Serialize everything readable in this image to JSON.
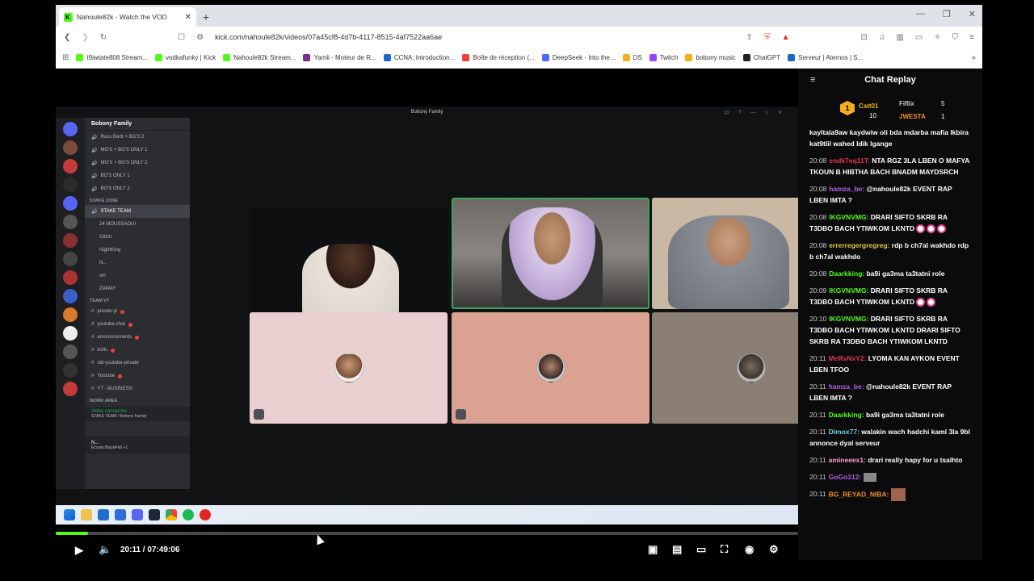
{
  "browser": {
    "tab_title": "Nahoule82k - Watch the VOD",
    "url": "kick.com/nahoule82k/videos/07a45cf8-4d7b-4117-8515-4af7522aa6ae",
    "bookmarks": [
      {
        "label": "t9iwtate808 Stream...",
        "color": "#53fc18"
      },
      {
        "label": "vodkafunky | Kick",
        "color": "#53fc18"
      },
      {
        "label": "Nahoule82k Stream...",
        "color": "#53fc18"
      },
      {
        "label": "Yamli - Moteur de R...",
        "color": "#7b2a8f"
      },
      {
        "label": "CCNA: Introduction...",
        "color": "#1b6ac9"
      },
      {
        "label": "Boîte de réception (...",
        "color": "#ea4335"
      },
      {
        "label": "DeepSeek - Into the...",
        "color": "#4d6bfe"
      },
      {
        "label": "DS",
        "color": "#f2b01e"
      },
      {
        "label": "Twitch",
        "color": "#9146ff"
      },
      {
        "label": "bobony music",
        "color": "#f2b01e"
      },
      {
        "label": "ChatGPT",
        "color": "#222"
      },
      {
        "label": "Serveur | Aternos | S...",
        "color": "#1b6ac9"
      }
    ]
  },
  "discord": {
    "window_title": "Bobony Family",
    "server_name": "Bobony Family",
    "channels": [
      "Rass Derb + BG'S 2",
      "MG'S + BG'S ONLY 1",
      "MG'S + BG'S ONLY 2",
      "BG'S ONLY 1",
      "BG'S ONLY 2"
    ],
    "category_stake": "STAKE ZONE",
    "active_voice": "STAKE TEAM",
    "voice_members": [
      "24 MOUSSAOUI",
      "Glitch",
      "NightKing",
      "N...",
      "vlri",
      "ZAWAY"
    ],
    "category_team": "TEAM VT",
    "text_channels": [
      "private-yt",
      "youtube-chat",
      "announcements",
      "trolls",
      "old-youtube-private",
      "Youtube",
      "YT - BUSINESS"
    ],
    "category_work": "WORK AREA",
    "voice_status": "Vidéo connectée",
    "voice_location": "STAKE TEAM / Bobony Family",
    "user_name": "N...",
    "user_status": "Écoute BlackPett +1"
  },
  "player": {
    "time_display": "20:11 / 07:49:06",
    "progress": 0.043
  },
  "chat": {
    "title": "Chat Replay",
    "leaders": [
      {
        "rank": "1",
        "name": "Catt01",
        "count": "10"
      },
      {
        "name": "Fiflix",
        "count": "5"
      },
      {
        "name": "JWESTA",
        "count": "1"
      }
    ],
    "messages": [
      {
        "time": "",
        "user": "",
        "user_color": "#fff",
        "text": "kayltala9aw kaydwiw oli bda mdarba mafia lkbira kat9tlil wahed ldik lgange"
      },
      {
        "time": "20:08",
        "user": "endk7eq11T:",
        "user_color": "#e0344f",
        "text": "NTA RGZ 3LA LBEN O MAFYA TKOUN B HIBTHA BACH BNADM MAYDSRCH"
      },
      {
        "time": "20:08",
        "user": "hamza_be:",
        "user_color": "#b45ce6",
        "text": "@nahoule82k EVENT RAP LBEN IMTA ?"
      },
      {
        "time": "20:08",
        "user": "IKGVNVMG:",
        "user_color": "#53fc18",
        "text": "DRARI SIFTO SKRB RA T3DBO BACH YTIWKOM LKNTD"
      },
      {
        "time": "20:08",
        "user": "errerregergregreg:",
        "user_color": "#e6c84a",
        "text": "rdp b ch7al wakhdo rdp b ch7al wakhdo"
      },
      {
        "time": "20:08",
        "user": "Daarkking:",
        "user_color": "#53fc18",
        "text": "ba9i ga3ma ta3tatni role"
      },
      {
        "time": "20:09",
        "user": "IKGVNVMG:",
        "user_color": "#53fc18",
        "text": "DRARI SIFTO SKRB RA T3DBO BACH YTIWKOM LKNTD"
      },
      {
        "time": "20:10",
        "user": "IKGVNVMG:",
        "user_color": "#53fc18",
        "text": "DRARI SIFTO SKRB RA T3DBO BACH YTIWKOM LKNTD DRARI SIFTO SKRB RA T3DBO BACH YTIWKOM LKNTD"
      },
      {
        "time": "20:11",
        "user": "MeRvNxY2:",
        "user_color": "#e0344f",
        "text": "LYOMA KAN AYKON EVENT LBEN TFOO"
      },
      {
        "time": "20:11",
        "user": "hamza_be:",
        "user_color": "#b45ce6",
        "text": "@nahoule82k EVENT RAP LBEN IMTA ?"
      },
      {
        "time": "20:11",
        "user": "Daarkking:",
        "user_color": "#53fc18",
        "text": "ba9i ga3ma ta3tatni role"
      },
      {
        "time": "20:11",
        "user": "Dimox77:",
        "user_color": "#73d2e6",
        "text": "walakin wach hadchi kaml 3la 9bl annonce dyal serveur"
      },
      {
        "time": "20:11",
        "user": "amineeex1:",
        "user_color": "#ffa3c8",
        "text": "drari really hapy for u tsalhto"
      },
      {
        "time": "20:11",
        "user": "GoGo312:",
        "user_color": "#b45ce6",
        "text": ""
      },
      {
        "time": "20:11",
        "user": "BG_REYAD_NIBA:",
        "user_color": "#f28c28",
        "text": ""
      }
    ]
  }
}
